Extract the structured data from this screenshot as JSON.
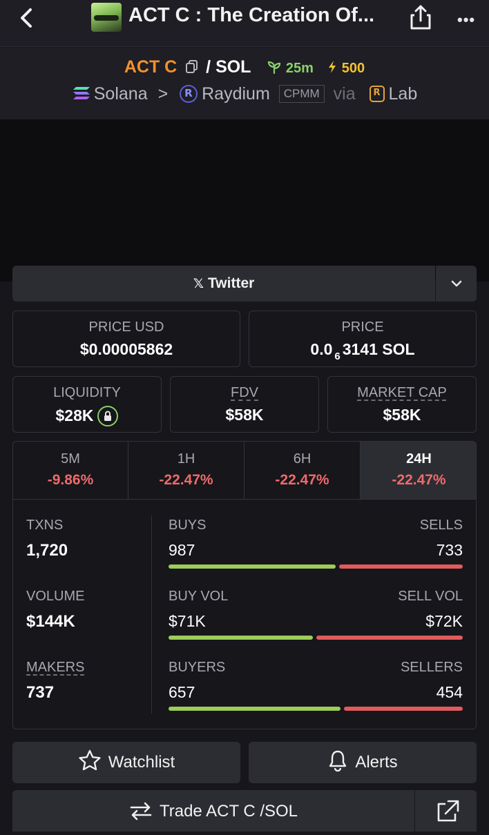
{
  "header": {
    "title": "ACT C : The Creation Of...",
    "back_icon": "chevron-left-icon",
    "share_icon": "share-icon",
    "more_icon": "ellipsis-icon"
  },
  "pair": {
    "base": "ACT C",
    "separator": "/",
    "quote": "SOL",
    "age": "25m",
    "boosts": "500",
    "chain": "Solana",
    "dex": "Raydium",
    "pool_type": "CPMM",
    "via": "via",
    "launchpad": "Lab"
  },
  "twitter": {
    "label": "Twitter",
    "icon": "x-logo-icon"
  },
  "price_usd": {
    "label": "PRICE USD",
    "value": "$0.00005862"
  },
  "price_native": {
    "label": "PRICE",
    "prefix": "0.0",
    "zeros": "6",
    "digits": "3141",
    "unit": "SOL"
  },
  "liquidity": {
    "label": "LIQUIDITY",
    "value": "$28K"
  },
  "fdv": {
    "label": "FDV",
    "value": "$58K"
  },
  "market_cap": {
    "label": "MARKET CAP",
    "value": "$58K"
  },
  "timeframes": [
    {
      "label": "5M",
      "change": "-9.86%"
    },
    {
      "label": "1H",
      "change": "-22.47%"
    },
    {
      "label": "6H",
      "change": "-22.47%"
    },
    {
      "label": "24H",
      "change": "-22.47%"
    }
  ],
  "metrics": {
    "txns": {
      "label": "TXNS",
      "value": "1,720"
    },
    "volume": {
      "label": "VOLUME",
      "value": "$144K"
    },
    "makers": {
      "label": "MAKERS",
      "value": "737"
    }
  },
  "ratios": {
    "buys": {
      "label": "BUYS",
      "value": "987",
      "sell_label": "SELLS",
      "sell_value": "733",
      "buy_fraction": 0.574
    },
    "vol": {
      "label": "BUY VOL",
      "value": "$71K",
      "sell_label": "SELL VOL",
      "sell_value": "$72K",
      "buy_fraction": 0.497
    },
    "buyers": {
      "label": "BUYERS",
      "value": "657",
      "sell_label": "SELLERS",
      "sell_value": "454",
      "buy_fraction": 0.591
    }
  },
  "actions": {
    "watchlist": "Watchlist",
    "alerts": "Alerts",
    "trade": "Trade ACT C /SOL"
  },
  "colors": {
    "base_token": "#f5912b",
    "positive": "#9ccc5a",
    "negative": "#e05b5b",
    "age": "#8ad06a",
    "boost": "#f4c232"
  }
}
